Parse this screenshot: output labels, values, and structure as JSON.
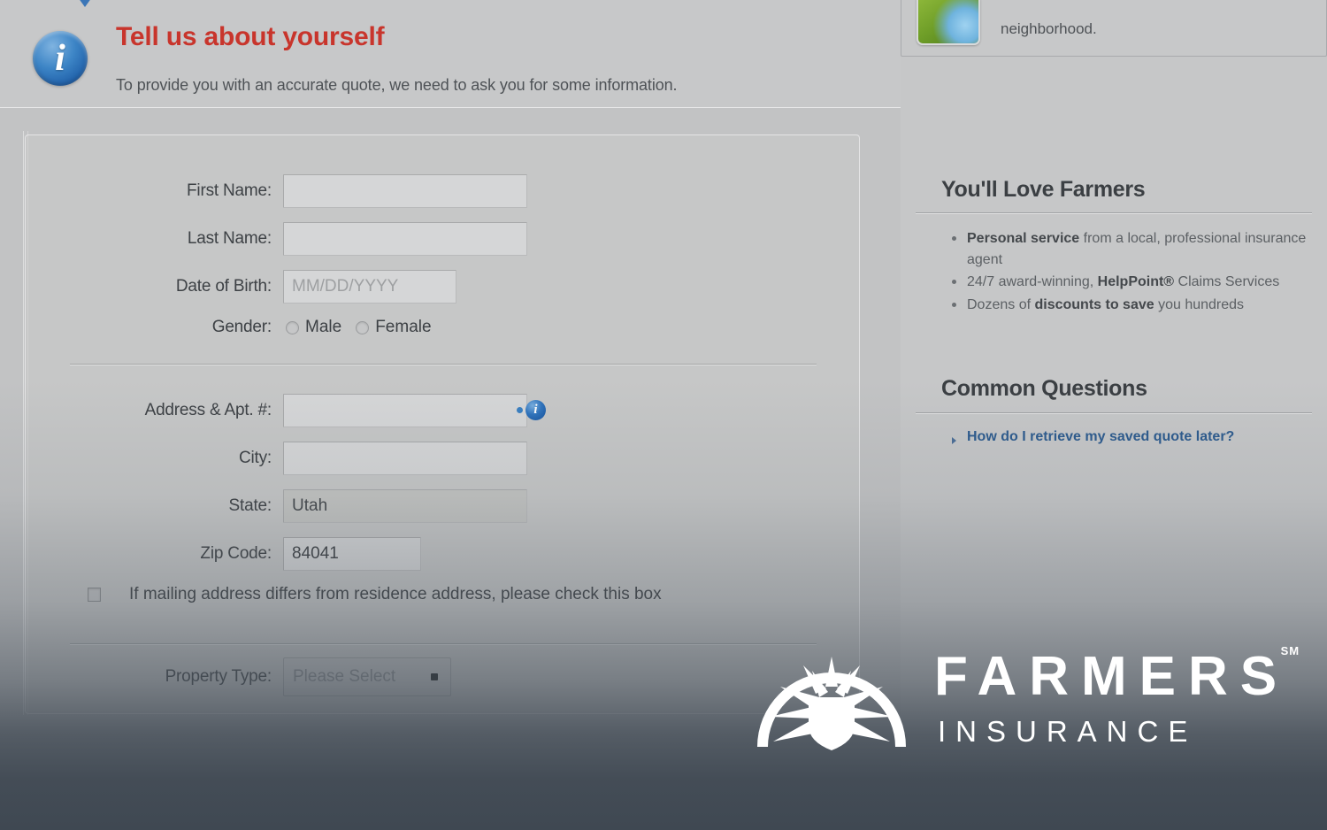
{
  "header": {
    "info_icon": "info-circle-icon",
    "title": "Tell us about yourself",
    "subtitle": "To provide you with an accurate quote, we need to ask you for some information."
  },
  "form": {
    "personal": {
      "first_name": {
        "label": "First Name:",
        "value": "",
        "placeholder": ""
      },
      "last_name": {
        "label": "Last Name:",
        "value": "",
        "placeholder": ""
      },
      "date_of_birth": {
        "label": "Date of Birth:",
        "value": "",
        "placeholder": "MM/DD/YYYY"
      },
      "gender": {
        "label": "Gender:",
        "options": [
          "Male",
          "Female"
        ],
        "male_label": "Male",
        "female_label": "Female",
        "selected": ""
      }
    },
    "address": {
      "street": {
        "label": "Address & Apt. #:",
        "value": "",
        "placeholder": ""
      },
      "city": {
        "label": "City:",
        "value": "",
        "placeholder": ""
      },
      "state": {
        "label": "State:",
        "value": "Utah",
        "disabled": true
      },
      "zip": {
        "label": "Zip Code:",
        "value": "84041"
      },
      "info_icon": "info-circle-icon",
      "mailing_checkbox": {
        "label": "If mailing address differs from residence address, please check this box",
        "checked": false
      }
    },
    "property": {
      "label": "Property Type:",
      "selected": "Please Select",
      "placeholder": "Please Select"
    }
  },
  "sidebar": {
    "promo": {
      "thumb_icon": "neighborhood-photo-icon",
      "text": "neighborhood."
    },
    "love_farmers": {
      "heading": "You'll Love Farmers",
      "bullets": [
        {
          "bold": "Personal service",
          "rest": " from a local, professional insurance agent"
        },
        {
          "bold": "",
          "rest_pre": "24/7 award-winning, ",
          "bold2": "HelpPoint®",
          "rest": " Claims Services"
        },
        {
          "bold": "",
          "rest_pre": "Dozens of ",
          "bold2": "discounts to save",
          "rest": " you hundreds"
        }
      ],
      "bullet_texts": [
        "Personal service from a local, professional insurance agent",
        "24/7 award-winning, HelpPoint® Claims Services",
        "Dozens of discounts to save you hundreds"
      ]
    },
    "common_questions": {
      "heading": "Common Questions",
      "links": [
        "How do I retrieve my saved quote later?"
      ],
      "link_1": "How do I retrieve my saved quote later?"
    }
  },
  "logo": {
    "mark": "farmers-shield-sunburst-icon",
    "brand": "FARMERS",
    "trademark": "SM",
    "subbrand": "INSURANCE"
  },
  "colors": {
    "title_red": "#c8352c",
    "link_blue": "#2d5b8e",
    "info_blue": "#2f73bc",
    "page_bg": "#c2c3c4",
    "overlay_dark": "#3f4852"
  }
}
